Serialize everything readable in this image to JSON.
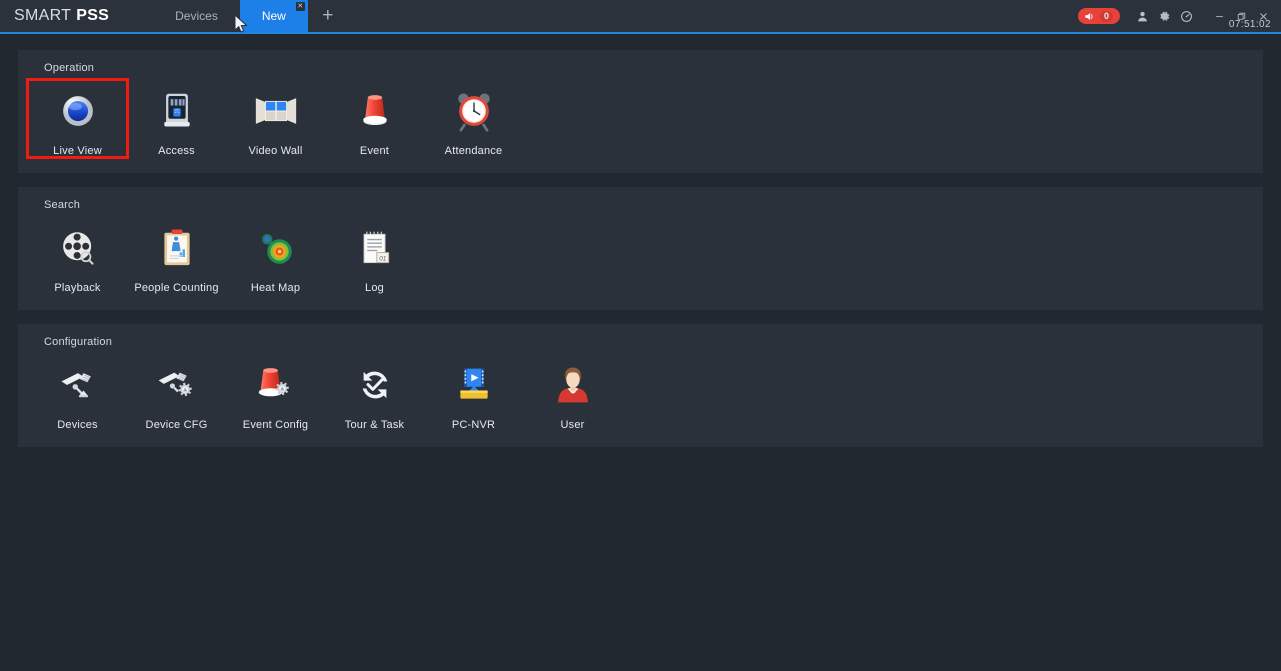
{
  "titlebar": {
    "brand_light": "SMART",
    "brand_bold": "PSS",
    "tabs": [
      {
        "label": "Devices",
        "active": false
      },
      {
        "label": "New",
        "active": true
      }
    ],
    "add_tab_label": "+",
    "close_tab_label": "✕",
    "alarm": {
      "icon": "speaker-alarm-icon",
      "count": "0",
      "color": "#e8413a"
    },
    "icons": [
      {
        "name": "user-icon"
      },
      {
        "name": "gear-icon"
      },
      {
        "name": "speedometer-icon"
      }
    ],
    "window_buttons": [
      {
        "name": "minimize-button",
        "glyph": "—"
      },
      {
        "name": "restore-button",
        "glyph": "❐"
      },
      {
        "name": "close-button",
        "glyph": "✕"
      }
    ],
    "clock": "07:51:02",
    "accent_color": "#2384e0",
    "active_tab_color": "#1d7fe8"
  },
  "sections": [
    {
      "title": "Operation",
      "items": [
        {
          "label": "Live View",
          "icon": "live-view-icon",
          "selected": true
        },
        {
          "label": "Access",
          "icon": "access-icon",
          "selected": false
        },
        {
          "label": "Video Wall",
          "icon": "video-wall-icon",
          "selected": false
        },
        {
          "label": "Event",
          "icon": "event-icon",
          "selected": false
        },
        {
          "label": "Attendance",
          "icon": "attendance-icon",
          "selected": false
        }
      ]
    },
    {
      "title": "Search",
      "items": [
        {
          "label": "Playback",
          "icon": "playback-icon",
          "selected": false
        },
        {
          "label": "People Counting",
          "icon": "people-counting-icon",
          "selected": false
        },
        {
          "label": "Heat Map",
          "icon": "heat-map-icon",
          "selected": false
        },
        {
          "label": "Log",
          "icon": "log-icon",
          "selected": false
        }
      ]
    },
    {
      "title": "Configuration",
      "items": [
        {
          "label": "Devices",
          "icon": "devices-icon",
          "selected": false
        },
        {
          "label": "Device CFG",
          "icon": "device-cfg-icon",
          "selected": false
        },
        {
          "label": "Event Config",
          "icon": "event-config-icon",
          "selected": false
        },
        {
          "label": "Tour & Task",
          "icon": "tour-task-icon",
          "selected": false
        },
        {
          "label": "PC-NVR",
          "icon": "pc-nvr-icon",
          "selected": false
        },
        {
          "label": "User",
          "icon": "user-config-icon",
          "selected": false
        }
      ]
    }
  ],
  "theme": {
    "page_bg": "#222830",
    "panel_bg": "#2b313a",
    "titlebar_bg": "#2c323b",
    "selection_border": "#ef1c14"
  }
}
